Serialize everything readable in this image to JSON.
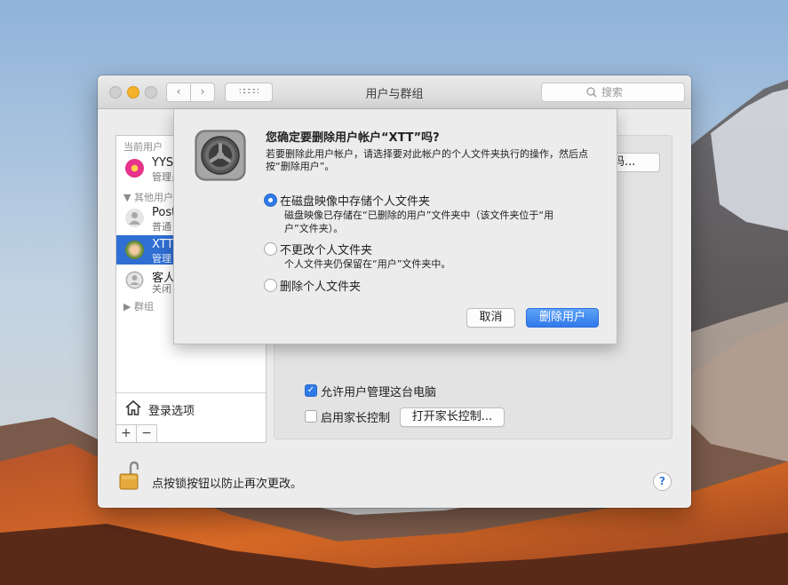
{
  "window": {
    "title": "用户与群组",
    "search_placeholder": "搜索",
    "nav_back": "‹",
    "nav_forward": "›",
    "show_all": "∷∷∷∷"
  },
  "sidebar": {
    "current_users_header": "当前用户",
    "other_users_header": "其他用户",
    "groups_header": "群组",
    "users": [
      {
        "name": "YYS",
        "role": "管理员"
      },
      {
        "name": "Post",
        "role": "普通"
      },
      {
        "name": "XTT",
        "role": "管理"
      },
      {
        "name": "客人",
        "role": "关闭"
      }
    ],
    "login_options": "登录选项",
    "add_button": "+",
    "remove_button": "−"
  },
  "pane": {
    "password_button": "码...",
    "allow_admin_label": "允许用户管理这台电脑",
    "allow_admin_checked": true,
    "parental_label": "启用家长控制",
    "parental_checked": false,
    "open_parental_button": "打开家长控制..."
  },
  "footer": {
    "lock_text": "点按锁按钮以防止再次更改。",
    "help": "?"
  },
  "sheet": {
    "title": "您确定要删除用户帐户“XTT”吗?",
    "description": "若要删除此用户帐户，请选择要对此帐户的个人文件夹执行的操作，然后点按“删除用户”。",
    "options": [
      {
        "label": "在磁盘映像中存储个人文件夹",
        "detail": "磁盘映像已存储在“已删除的用户”文件夹中（该文件夹位于“用户”文件夹）。",
        "selected": true
      },
      {
        "label": "不更改个人文件夹",
        "detail": "个人文件夹仍保留在“用户”文件夹中。",
        "selected": false
      },
      {
        "label": "删除个人文件夹",
        "detail": "",
        "selected": false
      }
    ],
    "cancel_button": "取消",
    "delete_button": "删除用户"
  },
  "colors": {
    "accent": "#2f7ae5",
    "selection": "#2f6fd3",
    "minimize": "#f5b12a"
  }
}
